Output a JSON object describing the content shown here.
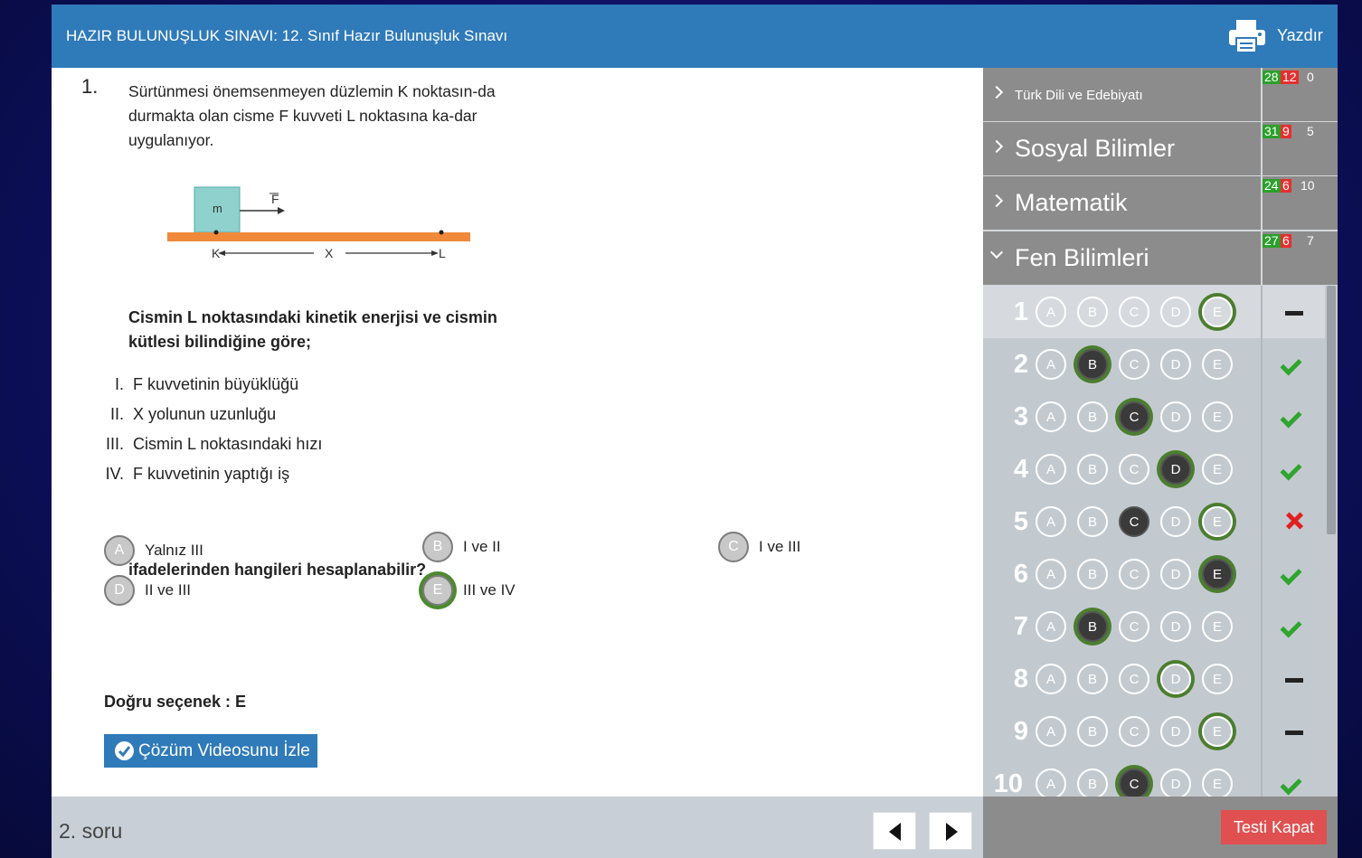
{
  "header": {
    "title": "HAZIR BULUNUŞLUK SINAVI: 12. Sınıf Hazır Bulunuşluk Sınavı",
    "print_label": "Yazdır"
  },
  "question": {
    "number": "1.",
    "stem": "Sürtünmesi önemsenmeyen düzlemin K noktasın-da durmakta olan cisme F kuvveti L noktasına ka-dar uygulanıyor.",
    "figure": {
      "mass": "m",
      "force": "F",
      "start": "K",
      "end": "L",
      "distance": "X"
    },
    "prompt": "Cismin L noktasındaki kinetik enerjisi ve cismin kütlesi bilindiğine göre;",
    "statements": [
      {
        "roman": "I.",
        "text": "F kuvvetinin büyüklüğü"
      },
      {
        "roman": "II.",
        "text": "X yolunun uzunluğu"
      },
      {
        "roman": "III.",
        "text": "Cismin L noktasındaki hızı"
      },
      {
        "roman": "IV.",
        "text": "F kuvvetinin yaptığı iş"
      }
    ],
    "ask": "ifadelerinden hangileri hesaplanabilir?",
    "options": [
      {
        "letter": "A",
        "text": "Yalnız III"
      },
      {
        "letter": "B",
        "text": "I ve II"
      },
      {
        "letter": "C",
        "text": "I ve III"
      },
      {
        "letter": "D",
        "text": "II ve III"
      },
      {
        "letter": "E",
        "text": "III ve IV"
      }
    ],
    "correct_text": "Doğru seçenek : E",
    "video_label": "Çözüm Videosunu İzle"
  },
  "footer": {
    "question_label": "2. soru",
    "close_label": "Testi Kapat"
  },
  "subjects": [
    {
      "name": "Türk Dili ve Edebiyatı",
      "correct": "28",
      "wrong": "12",
      "blank": "0"
    },
    {
      "name": "Sosyal Bilimler",
      "correct": "31",
      "wrong": "9",
      "blank": "5"
    },
    {
      "name": "Matematik",
      "correct": "24",
      "wrong": "6",
      "blank": "10"
    },
    {
      "name": "Fen Bilimleri",
      "correct": "27",
      "wrong": "6",
      "blank": "7"
    }
  ],
  "answer_rows": [
    {
      "num": "1",
      "result": "blank"
    },
    {
      "num": "2",
      "result": "correct"
    },
    {
      "num": "3",
      "result": "correct"
    },
    {
      "num": "4",
      "result": "correct"
    },
    {
      "num": "5",
      "result": "wrong"
    },
    {
      "num": "6",
      "result": "correct"
    },
    {
      "num": "7",
      "result": "correct"
    },
    {
      "num": "8",
      "result": "blank"
    },
    {
      "num": "9",
      "result": "blank"
    },
    {
      "num": "10",
      "result": "correct"
    }
  ],
  "colors": {
    "header": "#2f7ab9",
    "panel": "#8c8c8c",
    "correct": "#2c9f2c",
    "wrong": "#e62e2e",
    "ring": "#4b7e2f",
    "close": "#e05050"
  }
}
